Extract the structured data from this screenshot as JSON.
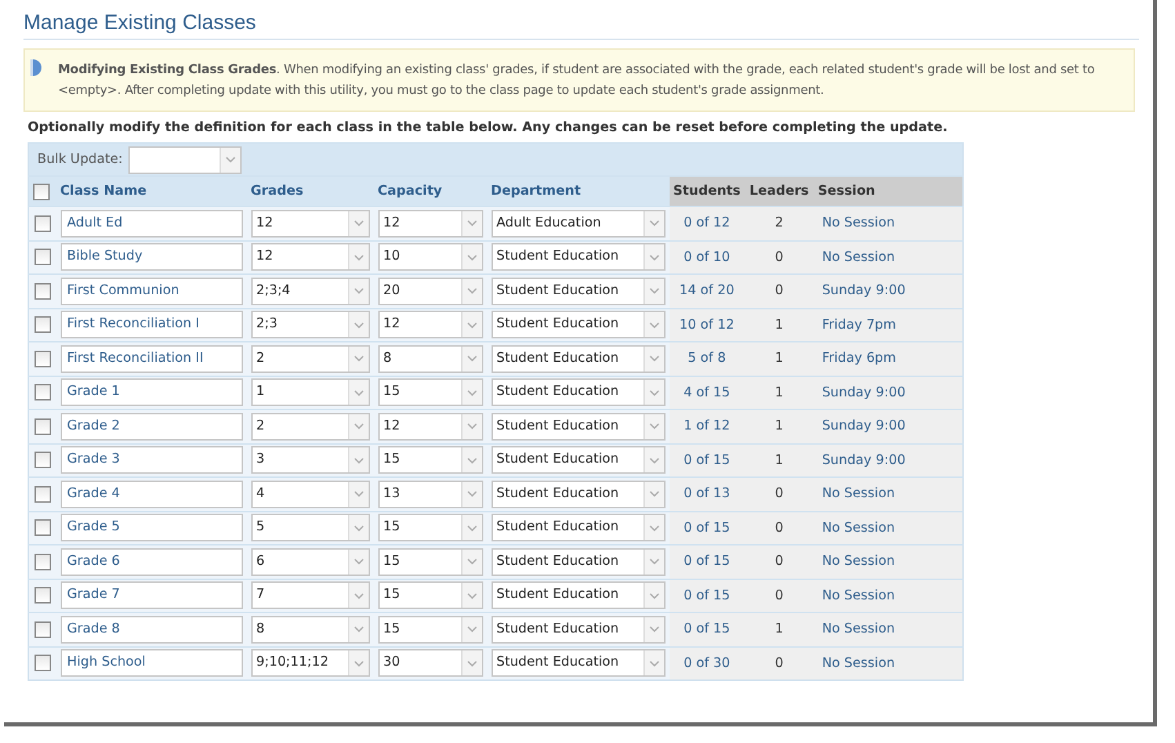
{
  "title": "Manage Existing Classes",
  "notice": {
    "heading": "Modifying Existing Class Grades",
    "text": ". When modifying an existing class' grades, if student are associated with the grade, each related student's grade will be lost and set to <empty>. After completing update with this utility, you must go to the class page to update each student's grade assignment."
  },
  "instruction": "Optionally modify the definition for each class in the table below. Any changes can be reset before completing the update.",
  "bulk_update": {
    "label": "Bulk Update:"
  },
  "select_all": {
    "checked": false
  },
  "columns": [
    "Class Name",
    "Grades",
    "Capacity",
    "Department",
    "Students",
    "Leaders",
    "Session"
  ],
  "rows": [
    {
      "checked": false,
      "class_name": "Adult Ed",
      "grades": "12",
      "capacity": "12",
      "department": "Adult Education",
      "students": "0 of 12",
      "leaders": "2",
      "session": "No Session"
    },
    {
      "checked": false,
      "class_name": "Bible Study",
      "grades": "12",
      "capacity": "10",
      "department": "Student Education",
      "students": "0 of 10",
      "leaders": "0",
      "session": "No Session"
    },
    {
      "checked": false,
      "class_name": "First Communion",
      "grades": "2;3;4",
      "capacity": "20",
      "department": "Student Education",
      "students": "14 of 20",
      "leaders": "0",
      "session": "Sunday 9:00"
    },
    {
      "checked": false,
      "class_name": "First Reconciliation I",
      "grades": "2;3",
      "capacity": "12",
      "department": "Student Education",
      "students": "10 of 12",
      "leaders": "1",
      "session": "Friday 7pm"
    },
    {
      "checked": false,
      "class_name": "First Reconciliation II",
      "grades": "2",
      "capacity": "8",
      "department": "Student Education",
      "students": "5 of 8",
      "leaders": "1",
      "session": "Friday 6pm"
    },
    {
      "checked": false,
      "class_name": "Grade 1",
      "grades": "1",
      "capacity": "15",
      "department": "Student Education",
      "students": "4 of 15",
      "leaders": "1",
      "session": "Sunday 9:00"
    },
    {
      "checked": false,
      "class_name": "Grade 2",
      "grades": "2",
      "capacity": "12",
      "department": "Student Education",
      "students": "1 of 12",
      "leaders": "1",
      "session": "Sunday 9:00"
    },
    {
      "checked": false,
      "class_name": "Grade 3",
      "grades": "3",
      "capacity": "15",
      "department": "Student Education",
      "students": "0 of 15",
      "leaders": "1",
      "session": "Sunday 9:00"
    },
    {
      "checked": false,
      "class_name": "Grade 4",
      "grades": "4",
      "capacity": "13",
      "department": "Student Education",
      "students": "0 of 13",
      "leaders": "0",
      "session": "No Session"
    },
    {
      "checked": false,
      "class_name": "Grade 5",
      "grades": "5",
      "capacity": "15",
      "department": "Student Education",
      "students": "0 of 15",
      "leaders": "0",
      "session": "No Session"
    },
    {
      "checked": false,
      "class_name": "Grade 6",
      "grades": "6",
      "capacity": "15",
      "department": "Student Education",
      "students": "0 of 15",
      "leaders": "0",
      "session": "No Session"
    },
    {
      "checked": false,
      "class_name": "Grade 7",
      "grades": "7",
      "capacity": "15",
      "department": "Student Education",
      "students": "0 of 15",
      "leaders": "0",
      "session": "No Session"
    },
    {
      "checked": false,
      "class_name": "Grade 8",
      "grades": "8",
      "capacity": "15",
      "department": "Student Education",
      "students": "0 of 15",
      "leaders": "1",
      "session": "No Session"
    },
    {
      "checked": false,
      "class_name": "High School",
      "grades": "9;10;11;12",
      "capacity": "30",
      "department": "Student Education",
      "students": "0 of 30",
      "leaders": "0",
      "session": "No Session"
    }
  ]
}
